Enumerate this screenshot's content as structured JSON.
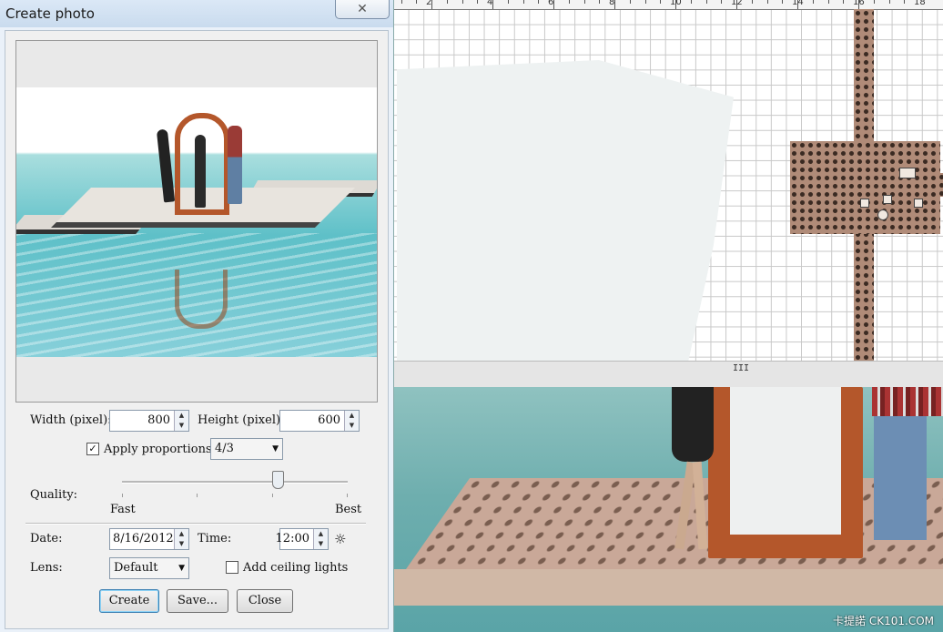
{
  "dialog": {
    "title": "Create photo",
    "close_glyph": "✕",
    "width_label": "Width (pixel):",
    "width_value": "800",
    "height_label": "Height (pixel):",
    "height_value": "600",
    "apply_proportions_label": "Apply proportions:",
    "apply_proportions_checked": true,
    "proportion_value": "4/3",
    "quality_label": "Quality:",
    "quality_fast": "Fast",
    "quality_best": "Best",
    "quality_level": 0.67,
    "date_label": "Date:",
    "date_value": "8/16/2012",
    "time_label": "Time:",
    "time_value": "12:00",
    "lens_label": "Lens:",
    "lens_value": "Default",
    "ceiling_lights_label": "Add ceiling lights",
    "ceiling_lights_checked": false,
    "buttons": {
      "create": "Create",
      "save": "Save...",
      "close": "Close"
    }
  },
  "plan": {
    "ruler_labels": [
      "2",
      "4",
      "6",
      "8",
      "10",
      "12",
      "14",
      "16",
      "18"
    ]
  },
  "splitter": {
    "grip": "III"
  },
  "view3d": {
    "watermark": "卡提諾 CK101.COM"
  },
  "icons": [
    "close-icon",
    "sun-icon",
    "check-icon",
    "spin-up-icon",
    "spin-down-icon",
    "dropdown-arrow-icon",
    "camera-icon"
  ]
}
